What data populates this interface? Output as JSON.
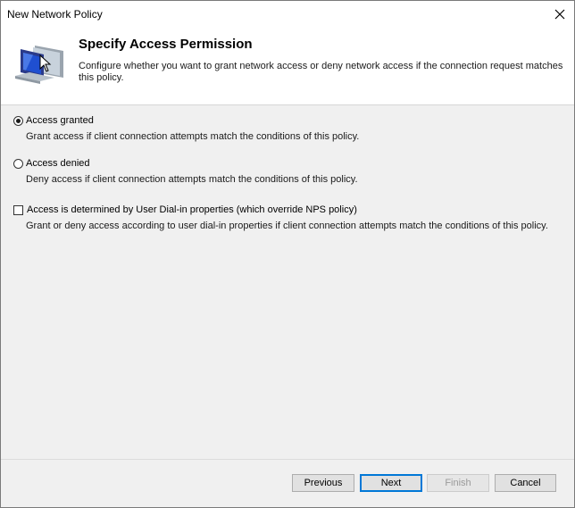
{
  "window": {
    "title": "New Network Policy"
  },
  "header": {
    "title": "Specify Access Permission",
    "description": "Configure whether you want to grant network access or deny network access if the connection request matches this policy."
  },
  "options": [
    {
      "type": "radio",
      "label": "Access granted",
      "description": "Grant access if client connection attempts match the conditions of this policy.",
      "checked": true
    },
    {
      "type": "radio",
      "label": "Access denied",
      "description": "Deny access if client connection attempts match the conditions of this policy.",
      "checked": false
    },
    {
      "type": "checkbox",
      "label": "Access is determined by User Dial-in properties (which override NPS policy)",
      "description": "Grant or deny access according to user dial-in properties if client connection attempts match the conditions of this policy.",
      "checked": false
    }
  ],
  "buttons": {
    "previous": "Previous",
    "next": "Next",
    "finish": "Finish",
    "cancel": "Cancel"
  },
  "icons": {
    "close": "close-icon",
    "header": "network-computer-icon"
  },
  "colors": {
    "accent": "#0078d7"
  }
}
